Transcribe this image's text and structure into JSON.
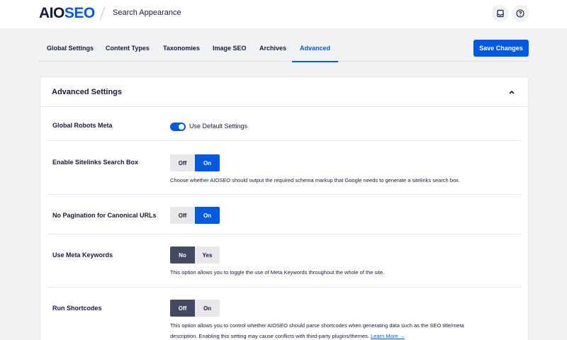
{
  "header": {
    "logo_aio": "AIO",
    "logo_seo": "SEO",
    "page_title": "Search Appearance",
    "icons": [
      "inbox-icon",
      "help-icon"
    ]
  },
  "tabs": [
    {
      "label": "Global Settings",
      "active": false
    },
    {
      "label": "Content Types",
      "active": false
    },
    {
      "label": "Taxonomies",
      "active": false
    },
    {
      "label": "Image SEO",
      "active": false
    },
    {
      "label": "Archives",
      "active": false
    },
    {
      "label": "Advanced",
      "active": true
    }
  ],
  "save_button": "Save Changes",
  "card": {
    "title": "Advanced Settings",
    "collapse_icon": "chevron-up-icon"
  },
  "settings": {
    "global_robots": {
      "label": "Global Robots Meta",
      "toggle_label": "Use Default Settings",
      "toggle_on": true
    },
    "sitelinks": {
      "label": "Enable Sitelinks Search Box",
      "options": [
        "Off",
        "On"
      ],
      "selected": "On",
      "description": "Choose whether AIOSEO should output the required schema markup that Google needs to generate a sitelinks search box."
    },
    "pagination": {
      "label": "No Pagination for Canonical URLs",
      "options": [
        "Off",
        "On"
      ],
      "selected": "On"
    },
    "meta_keywords": {
      "label": "Use Meta Keywords",
      "options": [
        "No",
        "Yes"
      ],
      "selected": "No",
      "description": "This option allows you to toggle the use of Meta Keywords throughout the whole of the site."
    },
    "shortcodes": {
      "label": "Run Shortcodes",
      "options": [
        "Off",
        "On"
      ],
      "selected": "Off",
      "description_line1": "This option allows you to control whether AIOSEO should parse shortcodes when generating data such as the SEO title/meta",
      "description_line2": "description. Enabling this setting may cause conflicts with third-party plugins/themes.",
      "learn_more": "Learn More →"
    }
  },
  "colors": {
    "accent": "#005ae0",
    "dark": "#434960",
    "text": "#141b38",
    "background": "#f1f2f4"
  }
}
